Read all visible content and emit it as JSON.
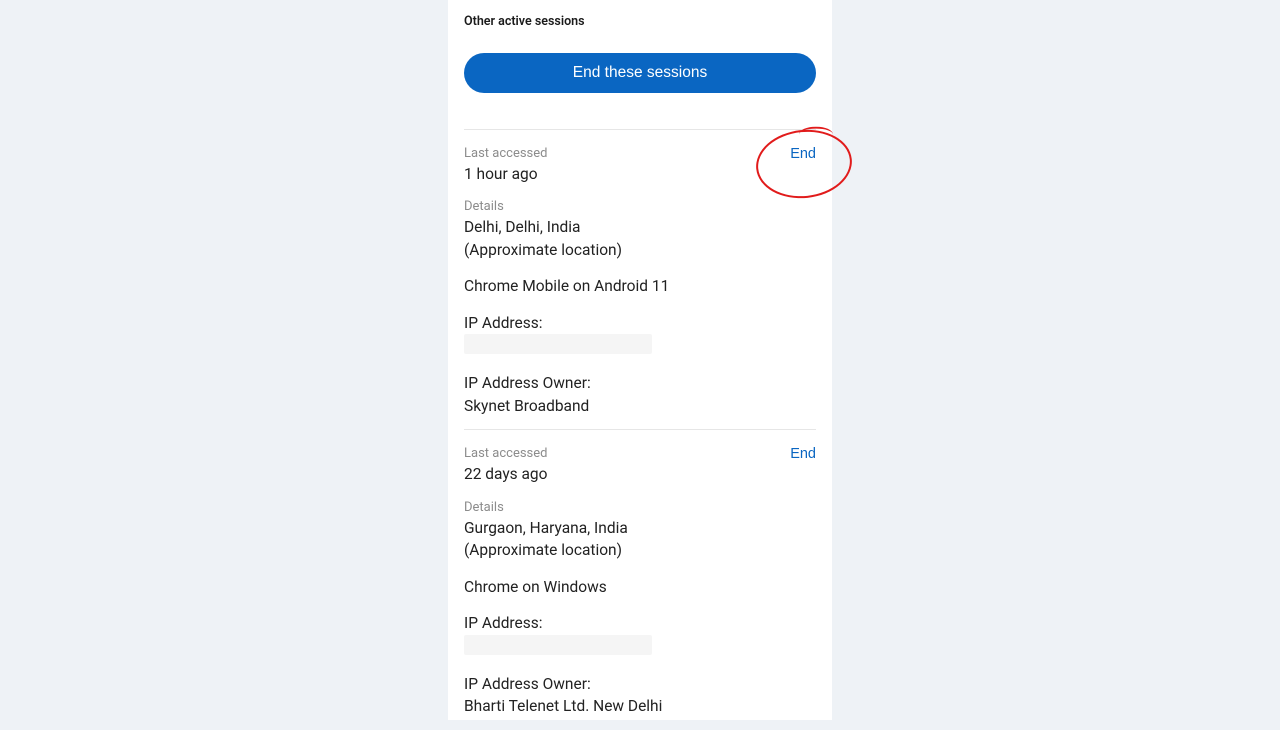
{
  "colors": {
    "accent": "#0a66c2",
    "annotation": "#e11b1b"
  },
  "section_title": "Other active sessions",
  "end_all_button": "End these sessions",
  "labels": {
    "last_accessed": "Last accessed",
    "details": "Details",
    "ip_address": "IP Address:",
    "ip_owner": "IP Address Owner:"
  },
  "end_link": "End",
  "sessions": [
    {
      "last_accessed": "1 hour ago",
      "location_line1": "Delhi, Delhi, India",
      "location_line2": "(Approximate location)",
      "device": "Chrome Mobile on Android 11",
      "ip_owner": "Skynet Broadband"
    },
    {
      "last_accessed": "22 days ago",
      "location_line1": "Gurgaon, Haryana, India",
      "location_line2": "(Approximate location)",
      "device": "Chrome on Windows",
      "ip_owner": "Bharti Telenet Ltd. New Delhi"
    }
  ]
}
